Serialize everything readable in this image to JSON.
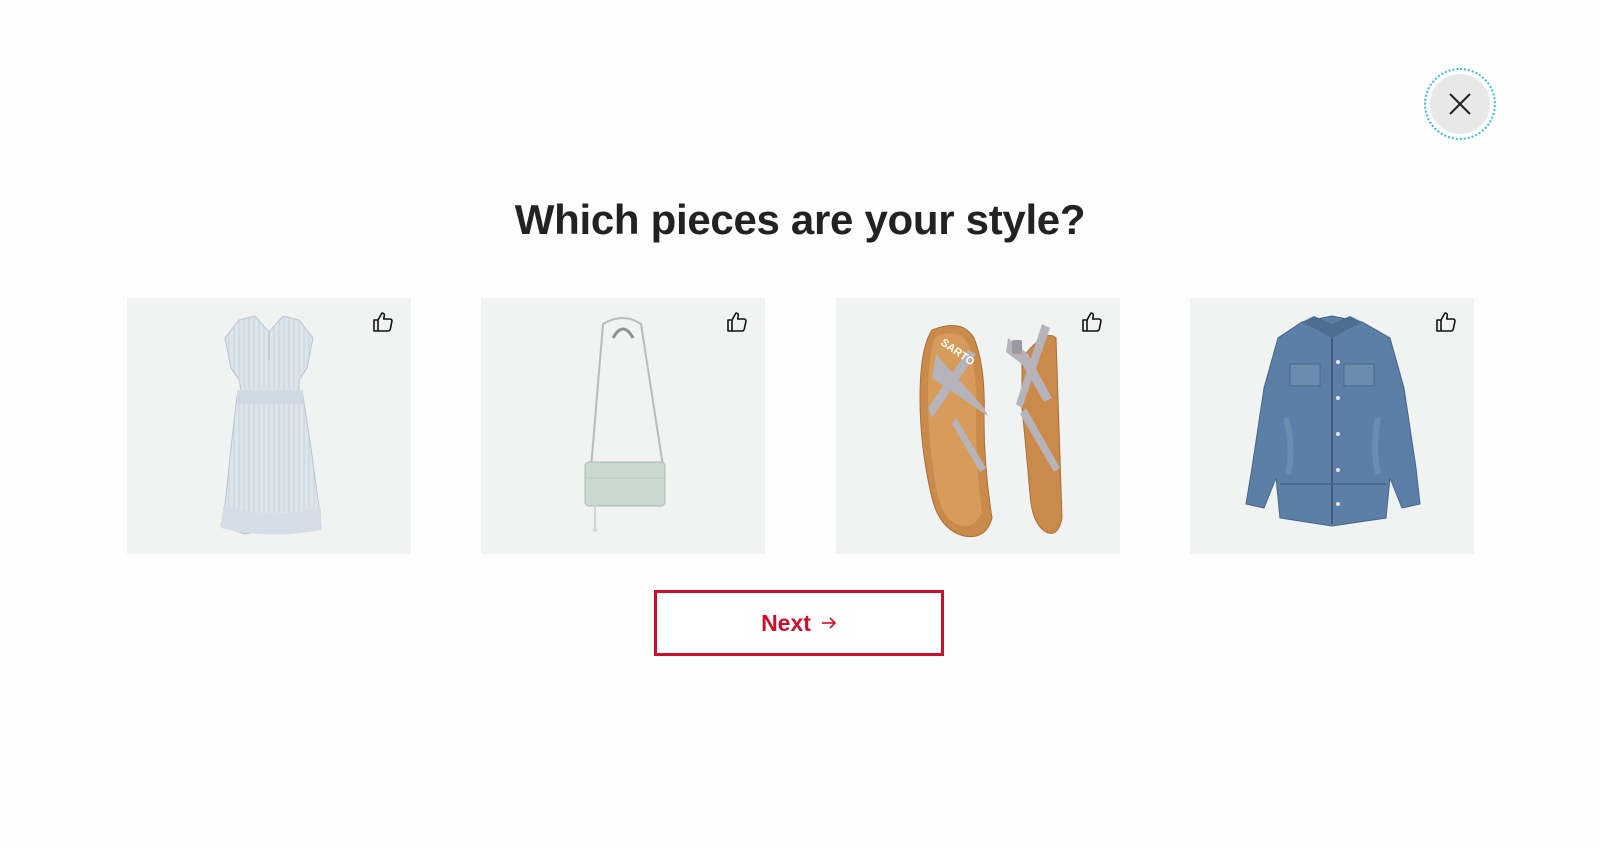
{
  "quiz": {
    "title": "Which pieces are your style?",
    "next_label": "Next",
    "items": [
      {
        "name": "dress",
        "icon": "dress-image"
      },
      {
        "name": "crossbody-bag",
        "icon": "bag-image"
      },
      {
        "name": "sandals",
        "icon": "sandals-image",
        "brand_text": "SARTO"
      },
      {
        "name": "denim-jacket",
        "icon": "jacket-image"
      }
    ]
  },
  "icons": {
    "close": "close-icon",
    "like": "thumbs-up-icon",
    "arrow": "arrow-right-icon"
  },
  "colors": {
    "accent": "#c8102e",
    "card_bg": "#f1f2f2",
    "focus_ring": "#3fb8d6"
  }
}
